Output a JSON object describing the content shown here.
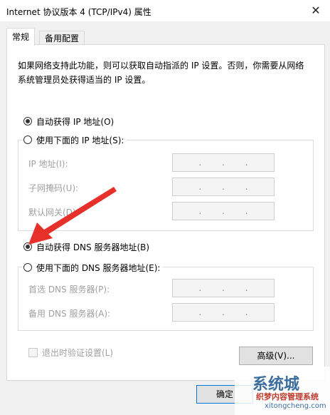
{
  "window": {
    "title": "Internet 协议版本 4 (TCP/IPv4) 属性",
    "close_glyph": "✕"
  },
  "tabs": [
    {
      "label": "常规",
      "active": true
    },
    {
      "label": "备用配置",
      "active": false
    }
  ],
  "description": "如果网络支持此功能，则可以获取自动指派的 IP 设置。否则，你需要从网络系统管理员处获得适当的 IP 设置。",
  "ip": {
    "auto_label": "自动获得 IP 地址(O)",
    "auto_selected": true,
    "manual_label": "使用下面的 IP 地址(S):",
    "fields": [
      {
        "label": "IP 地址(I):"
      },
      {
        "label": "子网掩码(U):"
      },
      {
        "label": "默认网关(D):"
      }
    ]
  },
  "dns": {
    "auto_label": "自动获得 DNS 服务器地址(B)",
    "auto_selected": true,
    "manual_label": "使用下面的 DNS 服务器地址(E):",
    "fields": [
      {
        "label": "首选 DNS 服务器(P):"
      },
      {
        "label": "备用 DNS 服务器(A):"
      }
    ]
  },
  "validate_label": "退出时验证设置(L)",
  "advanced_button": "高级(V)...",
  "ok_button": "确定",
  "annotation_color": "#e8302a",
  "watermark": {
    "main": "系统城",
    "sub": "织梦内容管理系统",
    "url": "xitongcheng.com"
  }
}
